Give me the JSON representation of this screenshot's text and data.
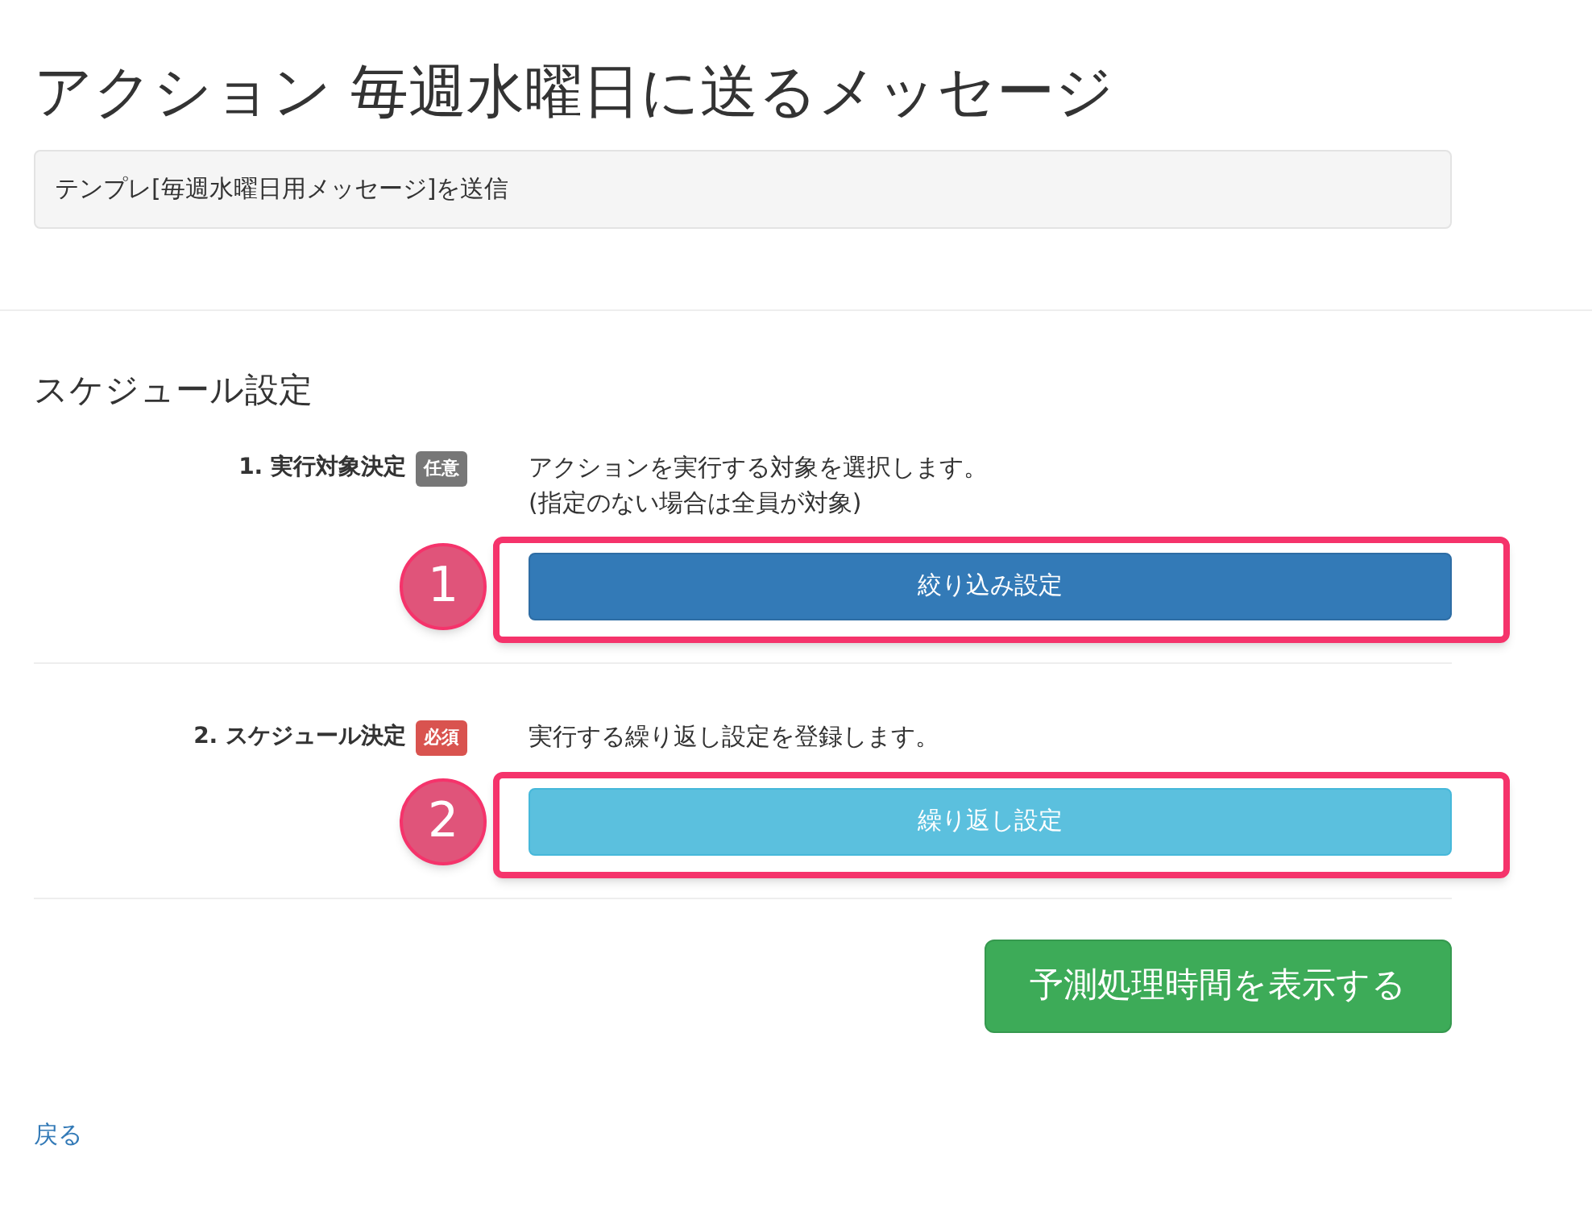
{
  "title": "アクション 毎週水曜日に送るメッセージ",
  "summary": "テンプレ[毎週水曜日用メッセージ]を送信",
  "section_title": "スケジュール設定",
  "steps": [
    {
      "label": "1. 実行対象決定",
      "badge": {
        "text": "任意",
        "kind": "optional"
      },
      "description": [
        "アクションを実行する対象を選択します。",
        "(指定のない場合は全員が対象)"
      ],
      "marker": "1",
      "button": {
        "label": "絞り込み設定",
        "kind": "primary"
      }
    },
    {
      "label": "2. スケジュール決定",
      "badge": {
        "text": "必須",
        "kind": "required"
      },
      "description": [
        "実行する繰り返し設定を登録します。"
      ],
      "marker": "2",
      "button": {
        "label": "繰り返し設定",
        "kind": "info"
      }
    }
  ],
  "submit_button": "予測処理時間を表示する",
  "back_link": "戻る"
}
